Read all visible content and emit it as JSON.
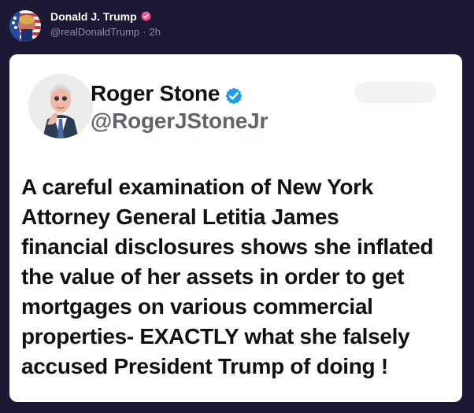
{
  "post": {
    "author_name": "Donald J. Trump",
    "author_handle": "@realDonaldTrump",
    "separator": "·",
    "timestamp": "2h",
    "verified_badge_color": "#ff4f8b"
  },
  "quoted_post": {
    "author_name": "Roger Stone",
    "author_handle": "@RogerJStoneJr",
    "verified_badge_color": "#1d9bf0",
    "text": "A careful examination of New York\nAttorney General Letitia James\nfinancial disclosures shows she inflated\nthe value of her assets in order to get\nmortgages on various commercial\nproperties- EXACTLY what she falsely\naccused President Trump of doing !"
  },
  "icons": {
    "pink_badge": "verified-badge-icon",
    "blue_badge": "verified-badge-icon",
    "top_avatar": "profile-avatar",
    "card_avatar": "profile-avatar"
  },
  "colors": {
    "background": "#1c1934",
    "card": "#ffffff",
    "muted_text": "#8f8ba8"
  }
}
